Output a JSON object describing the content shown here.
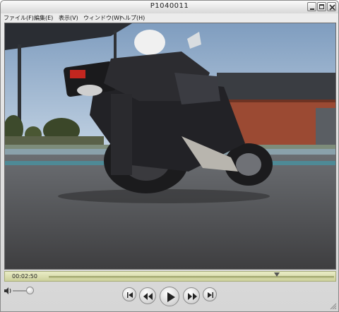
{
  "window": {
    "title": "P1040011"
  },
  "menu": [
    {
      "label": "ファイル(F)"
    },
    {
      "label": "編集(E)"
    },
    {
      "label": "表示(V)"
    },
    {
      "label": "ウィンドウ(W)"
    },
    {
      "label": "ヘルプ(H)"
    }
  ],
  "player": {
    "current_time": "00:02:50",
    "progress": 0.8,
    "volume": 0.8
  },
  "icons": {
    "minimize": "minimize-icon",
    "maximize": "maximize-icon",
    "close": "close-icon",
    "volume": "speaker-icon",
    "go_to_start": "skip-to-start-icon",
    "rewind": "rewind-icon",
    "play": "play-icon",
    "fast_forward": "fast-forward-icon",
    "go_to_end": "skip-to-end-icon"
  },
  "colors": {
    "timeline_bg": "#dcdfb0",
    "video_sky": "#9bb5cf",
    "video_road": "#4f4f52"
  }
}
